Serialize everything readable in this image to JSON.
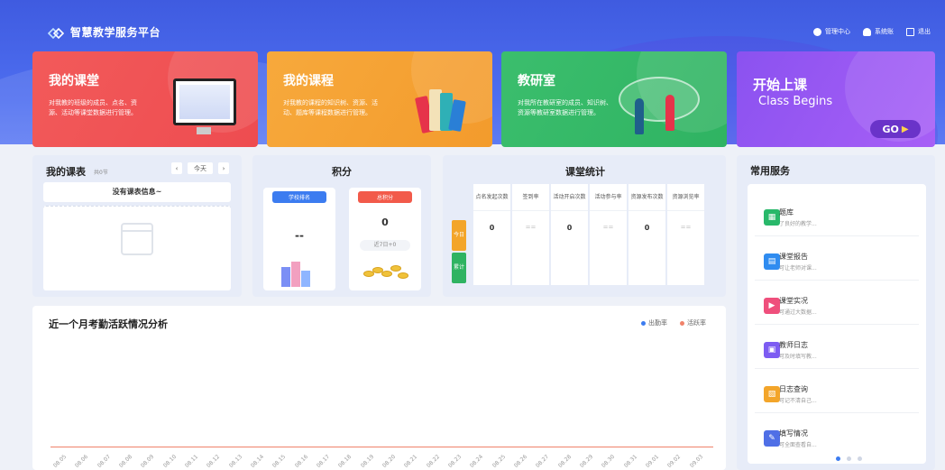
{
  "app": {
    "title": "智慧教学服务平台"
  },
  "top_actions": [
    {
      "label": "管理中心",
      "icon": "gear-icon"
    },
    {
      "label": "系统账",
      "icon": "user-icon"
    },
    {
      "label": "退出",
      "icon": "logout-icon"
    }
  ],
  "cards": [
    {
      "title": "我的课堂",
      "desc": "对我教的班级的成员、点名、资源、活动等课堂数据进行管理。",
      "color": "#f25a5a"
    },
    {
      "title": "我的课程",
      "desc": "对我教的课程的知识树、资源、活动、题库等课程数据进行管理。",
      "color": "#f7a93c"
    },
    {
      "title": "教研室",
      "desc": "对我所在教研室的成员、知识树、资源等教研室数据进行管理。",
      "color": "#3bbe6d"
    },
    {
      "title": "开始上课",
      "subtitle": "Class Begins",
      "button": "GO",
      "color": "#8b52f0"
    }
  ],
  "schedule": {
    "title": "我的课表",
    "count": "共0节",
    "today": "今天",
    "prev": "‹",
    "next": "›",
    "empty": "没有课表信息~"
  },
  "points": {
    "title": "积分",
    "rank_label": "学校排名",
    "rank_value": "--",
    "total_label": "总积分",
    "total_value": "0",
    "recent": "近7日+0"
  },
  "class_stats": {
    "title": "课堂统计",
    "rows": [
      "今日",
      "累计"
    ],
    "columns": [
      {
        "header": "点名发起次数",
        "today": "0"
      },
      {
        "header": "签到率",
        "today": "=="
      },
      {
        "header": "活动开启次数",
        "today": "0"
      },
      {
        "header": "活动参与率",
        "today": "=="
      },
      {
        "header": "资源发布次数",
        "today": "0"
      },
      {
        "header": "资源浏览率",
        "today": "=="
      }
    ]
  },
  "services": {
    "title": "常用服务",
    "items": [
      {
        "name": "题库",
        "desc": "了良好的教学...",
        "color": "#28b86a",
        "icon": "question-bank-icon"
      },
      {
        "name": "课堂报告",
        "desc": "可让老师对课...",
        "color": "#2f8cf0",
        "icon": "report-icon"
      },
      {
        "name": "课堂实况",
        "desc": "可通过大数据...",
        "color": "#ef4f7c",
        "icon": "play-icon"
      },
      {
        "name": "教师日志",
        "desc": "可及时填写教...",
        "color": "#7d5cf2",
        "icon": "log-icon"
      },
      {
        "name": "日志查询",
        "desc": "可记不清自己...",
        "color": "#f3a52a",
        "icon": "log-search-icon"
      },
      {
        "name": "填写情况",
        "desc": "可全面查看自...",
        "color": "#4f6fe6",
        "icon": "edit-icon"
      }
    ],
    "page_count": 3,
    "active_page": 0
  },
  "attendance": {
    "title": "近一个月考勤活跃情况分析",
    "legend": [
      {
        "name": "出勤率",
        "color": "#3c7cf0"
      },
      {
        "name": "活跃率",
        "color": "#f0826a"
      }
    ],
    "x_labels": [
      "08.05",
      "08.06",
      "08.07",
      "08.08",
      "08.09",
      "08.10",
      "08.11",
      "08.12",
      "08.13",
      "08.14",
      "08.15",
      "08.16",
      "08.17",
      "08.18",
      "08.19",
      "08.20",
      "08.21",
      "08.22",
      "08.23",
      "08.24",
      "08.25",
      "08.26",
      "08.27",
      "08.28",
      "08.29",
      "08.30",
      "08.31",
      "09.01",
      "09.02",
      "09.03"
    ]
  }
}
